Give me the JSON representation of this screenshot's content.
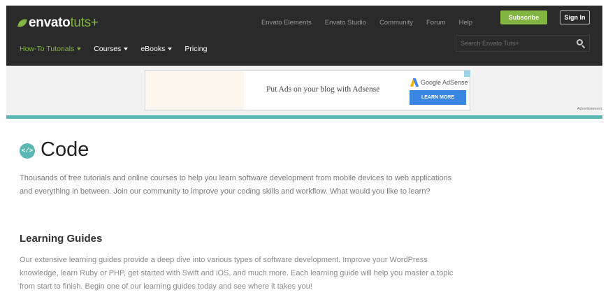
{
  "colors": {
    "brand_green": "#82b541",
    "header_bg": "#2a2a2a",
    "accent_teal": "#5bb7b3",
    "adsense_blue": "#3a86e0"
  },
  "header": {
    "logo_main": "envato",
    "logo_sub": "tuts+",
    "top_links": [
      "Envato Elements",
      "Envato Studio",
      "Community",
      "Forum",
      "Help"
    ],
    "subscribe_label": "Subscribe",
    "signin_label": "Sign In",
    "nav": [
      {
        "label": "How-To Tutorials",
        "active": true,
        "dropdown": true
      },
      {
        "label": "Courses",
        "active": false,
        "dropdown": true
      },
      {
        "label": "eBooks",
        "active": false,
        "dropdown": true
      },
      {
        "label": "Pricing",
        "active": false,
        "dropdown": false
      }
    ],
    "search_placeholder": "Search Envato Tuts+",
    "search_value": ""
  },
  "ad": {
    "text": "Put Ads on your blog with Adsense",
    "brand": "Google AdSense",
    "button_label": "LEARN MORE",
    "label": "Advertisement"
  },
  "main": {
    "icon_glyph": "</>",
    "title": "Code",
    "intro": "Thousands of free tutorials and online courses to help you learn software development from mobile devices to web applications and everything in between. Join our community to improve your coding skills and workflow. What would you like to learn?",
    "section_heading": "Learning Guides",
    "section_text": "Our extensive learning guides provide a deep dive into various types of software development. Improve your WordPress knowledge, learn Ruby or PHP, get started with Swift and iOS, and much more. Each learning guide will help you master a topic from start to finish. Begin one of our learning guides today and see where it takes you!"
  }
}
